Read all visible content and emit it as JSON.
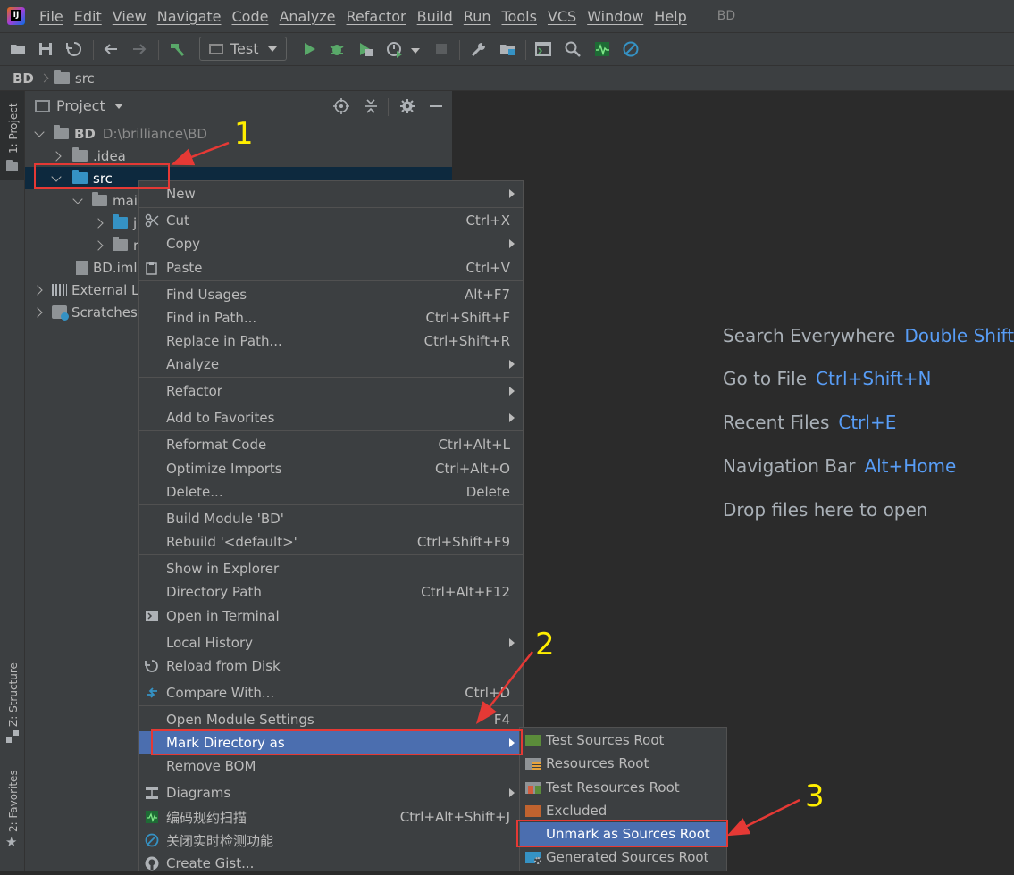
{
  "menubar": {
    "items": [
      "File",
      "Edit",
      "View",
      "Navigate",
      "Code",
      "Analyze",
      "Refactor",
      "Build",
      "Run",
      "Tools",
      "VCS",
      "Window",
      "Help"
    ],
    "title": "BD"
  },
  "toolbar": {
    "run_config": "Test"
  },
  "navbar": {
    "crumbs": [
      "BD",
      "src"
    ]
  },
  "side_tabs": {
    "project": "1: Project",
    "structure": "Z: Structure",
    "favorites": "2: Favorites"
  },
  "project_panel": {
    "title": "Project",
    "tree": {
      "root": "BD",
      "root_path": "D:\\brilliance\\BD",
      "idea": ".idea",
      "src": "src",
      "main": "mai",
      "java": "j",
      "res": "r",
      "iml": "BD.iml",
      "ext": "External Li",
      "scratches": "Scratches"
    }
  },
  "editor_hints": [
    {
      "label": "Search Everywhere",
      "key": "Double Shift"
    },
    {
      "label": "Go to File",
      "key": "Ctrl+Shift+N"
    },
    {
      "label": "Recent Files",
      "key": "Ctrl+E"
    },
    {
      "label": "Navigation Bar",
      "key": "Alt+Home"
    },
    {
      "label": "Drop files here to open",
      "key": ""
    }
  ],
  "context_menu": {
    "items": [
      {
        "label": "New",
        "shortcut": ""
      },
      {
        "label": "Cut",
        "shortcut": "Ctrl+X"
      },
      {
        "label": "Copy",
        "shortcut": ""
      },
      {
        "label": "Paste",
        "shortcut": "Ctrl+V"
      },
      {
        "label": "Find Usages",
        "shortcut": "Alt+F7"
      },
      {
        "label": "Find in Path...",
        "shortcut": "Ctrl+Shift+F"
      },
      {
        "label": "Replace in Path...",
        "shortcut": "Ctrl+Shift+R"
      },
      {
        "label": "Analyze",
        "shortcut": ""
      },
      {
        "label": "Refactor",
        "shortcut": ""
      },
      {
        "label": "Add to Favorites",
        "shortcut": ""
      },
      {
        "label": "Reformat Code",
        "shortcut": "Ctrl+Alt+L"
      },
      {
        "label": "Optimize Imports",
        "shortcut": "Ctrl+Alt+O"
      },
      {
        "label": "Delete...",
        "shortcut": "Delete"
      },
      {
        "label": "Build Module 'BD'",
        "shortcut": ""
      },
      {
        "label": "Rebuild '<default>'",
        "shortcut": "Ctrl+Shift+F9"
      },
      {
        "label": "Show in Explorer",
        "shortcut": ""
      },
      {
        "label": "Directory Path",
        "shortcut": "Ctrl+Alt+F12"
      },
      {
        "label": "Open in Terminal",
        "shortcut": ""
      },
      {
        "label": "Local History",
        "shortcut": ""
      },
      {
        "label": "Reload from Disk",
        "shortcut": ""
      },
      {
        "label": "Compare With...",
        "shortcut": "Ctrl+D"
      },
      {
        "label": "Open Module Settings",
        "shortcut": "F4"
      },
      {
        "label": "Mark Directory as",
        "shortcut": ""
      },
      {
        "label": "Remove BOM",
        "shortcut": ""
      },
      {
        "label": "Diagrams",
        "shortcut": ""
      },
      {
        "label": "编码规约扫描",
        "shortcut": "Ctrl+Alt+Shift+J"
      },
      {
        "label": "关闭实时检测功能",
        "shortcut": ""
      },
      {
        "label": "Create Gist...",
        "shortcut": ""
      }
    ]
  },
  "submenu": {
    "items": [
      {
        "label": "Test Sources Root"
      },
      {
        "label": "Resources Root"
      },
      {
        "label": "Test Resources Root"
      },
      {
        "label": "Excluded"
      },
      {
        "label": "Unmark as Sources Root"
      },
      {
        "label": "Generated Sources Root"
      }
    ]
  },
  "annotations": {
    "n1": "1",
    "n2": "2",
    "n3": "3"
  },
  "colors": {
    "accent": "#4b6eaf",
    "highlight_box": "#e53935",
    "annotation_number": "#ffee00",
    "folder_blue": "#3592c4",
    "key_blue": "#589df6"
  }
}
